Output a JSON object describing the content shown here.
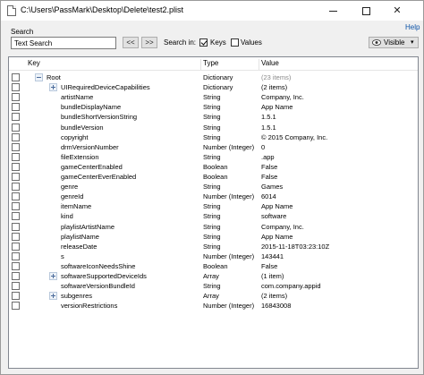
{
  "window": {
    "title": "C:\\Users\\PassMark\\Desktop\\Delete\\test2.plist",
    "help": "Help"
  },
  "search": {
    "label": "Search",
    "value": "Text Search",
    "prev_label": "<<",
    "next_label": ">>",
    "search_in_label": "Search in:",
    "keys_label": "Keys",
    "keys_checked": true,
    "values_label": "Values",
    "values_checked": false
  },
  "toolbar": {
    "visible_label": "Visible",
    "visible_caret": "▾"
  },
  "columns": {
    "key": "Key",
    "type": "Type",
    "value": "Value"
  },
  "rows": [
    {
      "key": "Root",
      "type": "Dictionary",
      "value": "(23 items)",
      "level": 0,
      "expander": "open",
      "dim": true
    },
    {
      "key": "UIRequiredDeviceCapabilities",
      "type": "Dictionary",
      "value": "(2 items)",
      "level": 1,
      "expander": "closed",
      "dim": false
    },
    {
      "key": "artistName",
      "type": "String",
      "value": "Company, Inc.",
      "level": 1,
      "expander": "none",
      "dim": false
    },
    {
      "key": "bundleDisplayName",
      "type": "String",
      "value": "App Name",
      "level": 1,
      "expander": "none",
      "dim": false
    },
    {
      "key": "bundleShortVersionString",
      "type": "String",
      "value": "1.5.1",
      "level": 1,
      "expander": "none",
      "dim": false
    },
    {
      "key": "bundleVersion",
      "type": "String",
      "value": "1.5.1",
      "level": 1,
      "expander": "none",
      "dim": false
    },
    {
      "key": "copyright",
      "type": "String",
      "value": "© 2015 Company, Inc.",
      "level": 1,
      "expander": "none",
      "dim": false
    },
    {
      "key": "drmVersionNumber",
      "type": "Number (Integer)",
      "value": "0",
      "level": 1,
      "expander": "none",
      "dim": false
    },
    {
      "key": "fileExtension",
      "type": "String",
      "value": ".app",
      "level": 1,
      "expander": "none",
      "dim": false
    },
    {
      "key": "gameCenterEnabled",
      "type": "Boolean",
      "value": "False",
      "level": 1,
      "expander": "none",
      "dim": false
    },
    {
      "key": "gameCenterEverEnabled",
      "type": "Boolean",
      "value": "False",
      "level": 1,
      "expander": "none",
      "dim": false
    },
    {
      "key": "genre",
      "type": "String",
      "value": "Games",
      "level": 1,
      "expander": "none",
      "dim": false
    },
    {
      "key": "genreId",
      "type": "Number (Integer)",
      "value": "6014",
      "level": 1,
      "expander": "none",
      "dim": false
    },
    {
      "key": "itemName",
      "type": "String",
      "value": "App Name",
      "level": 1,
      "expander": "none",
      "dim": false
    },
    {
      "key": "kind",
      "type": "String",
      "value": "software",
      "level": 1,
      "expander": "none",
      "dim": false
    },
    {
      "key": "playlistArtistName",
      "type": "String",
      "value": "Company, Inc.",
      "level": 1,
      "expander": "none",
      "dim": false
    },
    {
      "key": "playlistName",
      "type": "String",
      "value": "App Name",
      "level": 1,
      "expander": "none",
      "dim": false
    },
    {
      "key": "releaseDate",
      "type": "String",
      "value": "2015-11-18T03:23:10Z",
      "level": 1,
      "expander": "none",
      "dim": false
    },
    {
      "key": "s",
      "type": "Number (Integer)",
      "value": "143441",
      "level": 1,
      "expander": "none",
      "dim": false
    },
    {
      "key": "softwareIconNeedsShine",
      "type": "Boolean",
      "value": "False",
      "level": 1,
      "expander": "none",
      "dim": false
    },
    {
      "key": "softwareSupportedDeviceIds",
      "type": "Array",
      "value": "(1 item)",
      "level": 1,
      "expander": "closed",
      "dim": false
    },
    {
      "key": "softwareVersionBundleId",
      "type": "String",
      "value": "com.company.appid",
      "level": 1,
      "expander": "none",
      "dim": false
    },
    {
      "key": "subgenres",
      "type": "Array",
      "value": "(2 items)",
      "level": 1,
      "expander": "closed",
      "dim": false
    },
    {
      "key": "versionRestrictions",
      "type": "Number (Integer)",
      "value": "16843008",
      "level": 1,
      "expander": "none",
      "dim": false
    }
  ]
}
